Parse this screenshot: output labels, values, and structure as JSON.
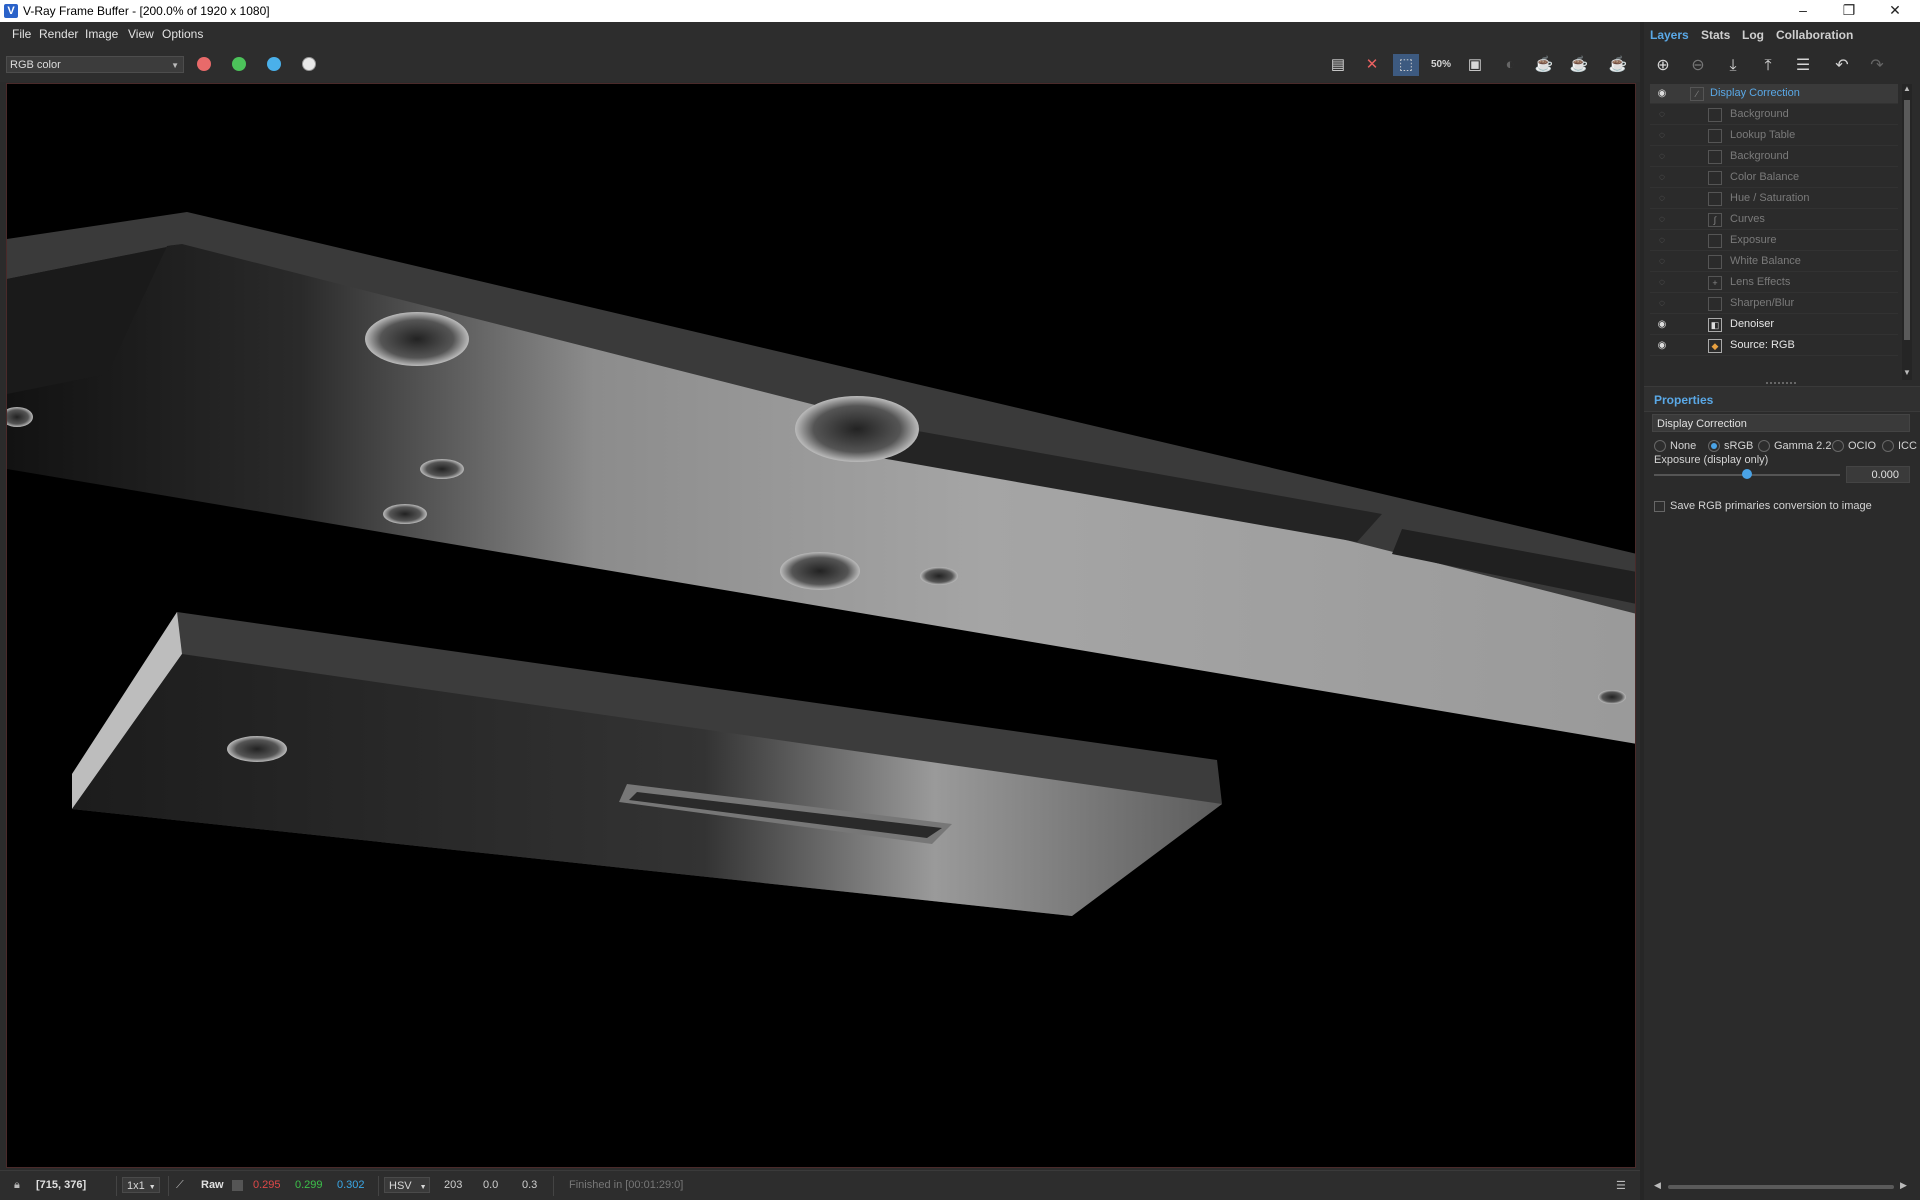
{
  "window": {
    "title": "V-Ray Frame Buffer - [200.0% of 1920 x 1080]",
    "minimize": "–",
    "maximize": "❐",
    "close": "✕"
  },
  "menu": [
    "File",
    "Render",
    "Image",
    "View",
    "Options"
  ],
  "toolbar": {
    "channel": "RGB color",
    "colors": {
      "red": "#e04848",
      "green": "#3cc04a",
      "blue": "#3aa8e8"
    }
  },
  "right_panel": {
    "tabs": [
      "Layers",
      "Stats",
      "Log",
      "Collaboration"
    ],
    "layers": [
      {
        "name": "Display Correction",
        "visible": true,
        "selected": true
      },
      {
        "name": "Background",
        "visible": false
      },
      {
        "name": "Lookup Table",
        "visible": false
      },
      {
        "name": "Background",
        "visible": false
      },
      {
        "name": "Color Balance",
        "visible": false
      },
      {
        "name": "Hue / Saturation",
        "visible": false
      },
      {
        "name": "Curves",
        "visible": false
      },
      {
        "name": "Exposure",
        "visible": false
      },
      {
        "name": "White Balance",
        "visible": false
      },
      {
        "name": "Lens Effects",
        "visible": false
      },
      {
        "name": "Sharpen/Blur",
        "visible": false
      },
      {
        "name": "Denoiser",
        "visible": true
      },
      {
        "name": "Source: RGB",
        "visible": true
      }
    ],
    "properties": {
      "tab": "Properties",
      "section": "Display Correction",
      "modes": [
        "None",
        "sRGB",
        "Gamma 2.2",
        "OCIO",
        "ICC"
      ],
      "selected_mode": "sRGB",
      "exposure_label": "Exposure (display only)",
      "exposure_value": "0.000",
      "save_rgb_label": "Save RGB primaries conversion to image"
    }
  },
  "status": {
    "coords": "[715, 376]",
    "sampling": "1x1",
    "raw_label": "Raw",
    "r": "0.295",
    "g": "0.299",
    "b": "0.302",
    "colorspace": "HSV",
    "h": "203",
    "s": "0.0",
    "v": "0.3",
    "message": "Finished in [00:01:29:0]"
  }
}
